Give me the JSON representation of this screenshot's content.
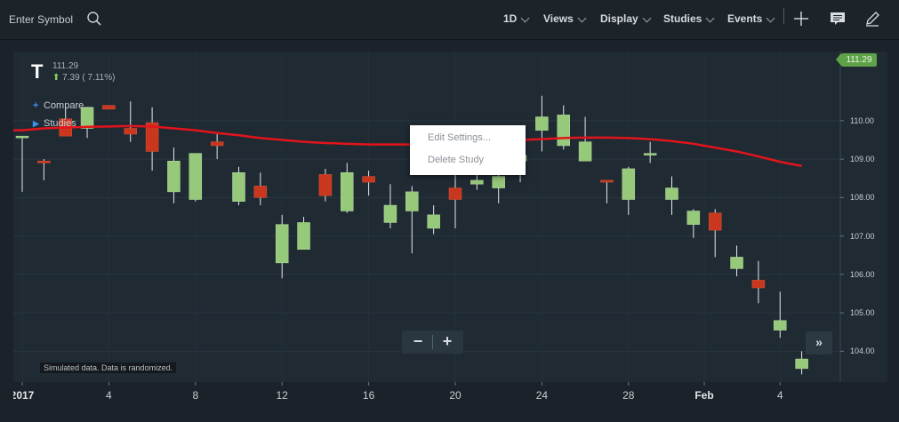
{
  "toolbar": {
    "symbol_placeholder": "Enter Symbol",
    "menus": [
      "1D",
      "Views",
      "Display",
      "Studies",
      "Events"
    ]
  },
  "symbol": {
    "letter": "T",
    "price": "111.29",
    "change": "7.39 ( 7.11%)"
  },
  "chart_controls": {
    "compare_label": "Compare...",
    "studies_label": "Studies"
  },
  "context_menu": {
    "items": [
      "Edit Settings...",
      "Delete Study"
    ]
  },
  "zoom": {
    "minus": "−",
    "plus": "+"
  },
  "forward_label": "»",
  "disclaimer": "Simulated data. Data is randomized.",
  "last_price": "111.29",
  "colors": {
    "up": "#97c97a",
    "down": "#c9381e",
    "ma_line": "#e3141b",
    "background": "#1f2a33",
    "last_price_flag": "#5ea34a"
  },
  "icons": {
    "search": "search-icon",
    "crosshair": "plus-icon",
    "comment": "comment-icon",
    "draw": "pencil-icon",
    "forward": "fast-forward-icon"
  },
  "chart_data": {
    "type": "candlestick",
    "x_labels": [
      "2017",
      "4",
      "8",
      "12",
      "16",
      "20",
      "24",
      "28",
      "Feb",
      "4"
    ],
    "y_ticks": [
      "110.00",
      "109.00",
      "108.00",
      "107.00",
      "106.00",
      "105.00",
      "104.00"
    ],
    "ylim": [
      103.2,
      111.8
    ],
    "grid": true,
    "candles": [
      {
        "o": 109.6,
        "h": 109.6,
        "l": 108.15,
        "c": 109.6
      },
      {
        "o": 108.95,
        "h": 109.0,
        "l": 108.45,
        "c": 108.9
      },
      {
        "o": 110.05,
        "h": 110.35,
        "l": 109.65,
        "c": 109.6
      },
      {
        "o": 109.8,
        "h": 110.35,
        "l": 109.55,
        "c": 110.35
      },
      {
        "o": 110.4,
        "h": 110.4,
        "l": 110.3,
        "c": 110.3
      },
      {
        "o": 109.8,
        "h": 110.5,
        "l": 109.45,
        "c": 109.65
      },
      {
        "o": 109.95,
        "h": 110.35,
        "l": 108.7,
        "c": 109.2
      },
      {
        "o": 108.15,
        "h": 109.3,
        "l": 107.85,
        "c": 108.95
      },
      {
        "o": 107.95,
        "h": 109.15,
        "l": 107.9,
        "c": 109.15
      },
      {
        "o": 109.45,
        "h": 109.7,
        "l": 109.0,
        "c": 109.35
      },
      {
        "o": 107.9,
        "h": 108.8,
        "l": 107.8,
        "c": 108.65
      },
      {
        "o": 108.3,
        "h": 108.65,
        "l": 107.8,
        "c": 108.0
      },
      {
        "o": 106.3,
        "h": 107.55,
        "l": 105.9,
        "c": 107.3
      },
      {
        "o": 106.65,
        "h": 107.5,
        "l": 106.65,
        "c": 107.35
      },
      {
        "o": 108.6,
        "h": 108.75,
        "l": 107.9,
        "c": 108.05
      },
      {
        "o": 107.65,
        "h": 108.9,
        "l": 107.6,
        "c": 108.65
      },
      {
        "o": 108.55,
        "h": 108.7,
        "l": 108.05,
        "c": 108.4
      },
      {
        "o": 107.35,
        "h": 108.35,
        "l": 107.2,
        "c": 107.8
      },
      {
        "o": 107.65,
        "h": 108.3,
        "l": 106.55,
        "c": 108.15
      },
      {
        "o": 107.2,
        "h": 107.8,
        "l": 107.05,
        "c": 107.55
      },
      {
        "o": 108.25,
        "h": 108.6,
        "l": 107.2,
        "c": 107.95
      },
      {
        "o": 108.35,
        "h": 109.4,
        "l": 108.2,
        "c": 108.45
      },
      {
        "o": 108.25,
        "h": 108.85,
        "l": 107.85,
        "c": 108.55
      },
      {
        "o": 108.95,
        "h": 109.45,
        "l": 108.4,
        "c": 109.1
      },
      {
        "o": 109.75,
        "h": 110.65,
        "l": 109.2,
        "c": 110.1
      },
      {
        "o": 109.35,
        "h": 110.4,
        "l": 109.25,
        "c": 110.15
      },
      {
        "o": 108.95,
        "h": 110.1,
        "l": 108.95,
        "c": 109.45
      },
      {
        "o": 108.45,
        "h": 108.45,
        "l": 107.85,
        "c": 108.4
      },
      {
        "o": 107.95,
        "h": 108.8,
        "l": 107.55,
        "c": 108.75
      },
      {
        "o": 109.15,
        "h": 109.45,
        "l": 108.9,
        "c": 109.15
      },
      {
        "o": 107.95,
        "h": 108.55,
        "l": 107.55,
        "c": 108.25
      },
      {
        "o": 107.3,
        "h": 107.7,
        "l": 106.95,
        "c": 107.65
      },
      {
        "o": 107.6,
        "h": 107.7,
        "l": 106.45,
        "c": 107.15
      },
      {
        "o": 106.15,
        "h": 106.75,
        "l": 105.95,
        "c": 106.45
      },
      {
        "o": 105.85,
        "h": 106.35,
        "l": 105.25,
        "c": 105.65
      },
      {
        "o": 104.55,
        "h": 105.55,
        "l": 104.35,
        "c": 104.8
      },
      {
        "o": 103.55,
        "h": 104.0,
        "l": 103.4,
        "c": 103.8
      }
    ],
    "moving_average": [
      109.75,
      109.8,
      109.82,
      109.84,
      109.85,
      109.86,
      109.85,
      109.8,
      109.75,
      109.68,
      109.62,
      109.55,
      109.5,
      109.45,
      109.42,
      109.4,
      109.38,
      109.38,
      109.38,
      109.4,
      109.43,
      109.45,
      109.48,
      109.5,
      109.52,
      109.55,
      109.56,
      109.56,
      109.55,
      109.52,
      109.47,
      109.4,
      109.3,
      109.2,
      109.07,
      108.93,
      108.82
    ]
  }
}
